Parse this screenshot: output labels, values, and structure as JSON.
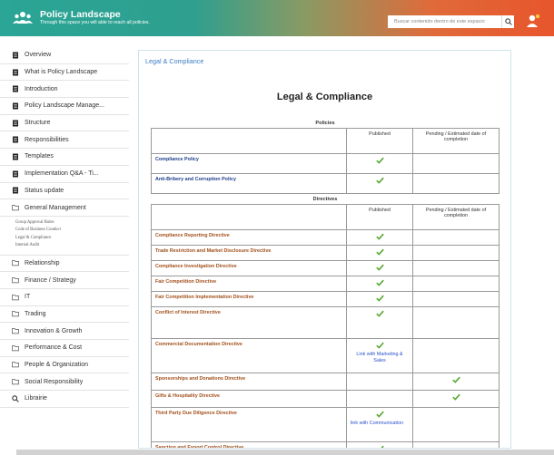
{
  "header": {
    "title": "Policy Landscape",
    "subtitle": "Through this space you will able to reach all policies.",
    "search_placeholder": "Buscar contenido dentro de este espacio"
  },
  "sidebar": {
    "items_top": [
      {
        "label": "Overview",
        "icon": "document-icon"
      },
      {
        "label": "What is Policy Landscape",
        "icon": "document-icon"
      },
      {
        "label": "Introduction",
        "icon": "document-icon"
      },
      {
        "label": "Policy Landscape Manage...",
        "icon": "document-icon"
      },
      {
        "label": "Structure",
        "icon": "document-icon"
      },
      {
        "label": "Responsibilities",
        "icon": "document-icon"
      },
      {
        "label": "Templates",
        "icon": "document-icon"
      },
      {
        "label": "Implementation Q&A - Ti...",
        "icon": "document-icon"
      },
      {
        "label": "Status update",
        "icon": "document-icon"
      },
      {
        "label": "General Management",
        "icon": "folder-icon"
      }
    ],
    "subitems": [
      "Group Approval Rules",
      "Code of Business Conduct",
      "Legal & Compliance",
      "Internal Audit"
    ],
    "items_bottom": [
      {
        "label": "Relationship",
        "icon": "folder-icon"
      },
      {
        "label": "Finance / Strategy",
        "icon": "folder-icon"
      },
      {
        "label": "IT",
        "icon": "folder-icon"
      },
      {
        "label": "Trading",
        "icon": "folder-icon"
      },
      {
        "label": "Innovation & Growth",
        "icon": "folder-icon"
      },
      {
        "label": "Performance & Cost",
        "icon": "folder-icon"
      },
      {
        "label": "People & Organization",
        "icon": "folder-icon"
      },
      {
        "label": "Social Responsibility",
        "icon": "folder-icon"
      },
      {
        "label": "Librairie",
        "icon": "search-icon"
      }
    ]
  },
  "main": {
    "breadcrumb": "Legal & Compliance",
    "title": "Legal & Compliance",
    "policies": {
      "section_title": "Policies",
      "col_published": "Published",
      "col_pending": "Pending / Estimated date of completion",
      "rows": [
        {
          "name": "Compliance Policy",
          "published": true,
          "pending": false,
          "link": ""
        },
        {
          "name": "Anti-Bribery and Corruption Policy",
          "published": true,
          "pending": false,
          "link": ""
        }
      ]
    },
    "directives": {
      "section_title": "Directives",
      "col_published": "Published",
      "col_pending": "Pending / Estimated date of completion",
      "rows": [
        {
          "name": "Compliance Reporting Directive",
          "published": true,
          "pending": false,
          "link": ""
        },
        {
          "name": "Trade Restriction and Market Disclosure Directive",
          "published": true,
          "pending": false,
          "link": ""
        },
        {
          "name": "Compliance Investigation Directive",
          "published": true,
          "pending": false,
          "link": ""
        },
        {
          "name": "Fair Competition Directive",
          "published": true,
          "pending": false,
          "link": ""
        },
        {
          "name": "Fair Competition Implementation Directive",
          "published": true,
          "pending": false,
          "link": ""
        },
        {
          "name": "Conflict of Interest Directive",
          "published": true,
          "pending": false,
          "link": ""
        },
        {
          "name": "Commercial Documentation Directive",
          "published": true,
          "pending": false,
          "link": "Link with Marketing & Sales"
        },
        {
          "name": "Sponsorships and Donations Directive",
          "published": false,
          "pending": true,
          "link": ""
        },
        {
          "name": "Gifts & Hospitality Directive",
          "published": false,
          "pending": true,
          "link": ""
        },
        {
          "name": "Third Party Due Diligence Directive",
          "published": true,
          "pending": false,
          "link": "link with Communication"
        },
        {
          "name": "Sanction and Export Control Directive",
          "published": true,
          "pending": false,
          "link": ""
        }
      ]
    }
  },
  "colors": {
    "check": "#5aa832",
    "policy_name": "#1e3f8a",
    "directive_name": "#a3501b",
    "link": "#2a4fcc"
  }
}
